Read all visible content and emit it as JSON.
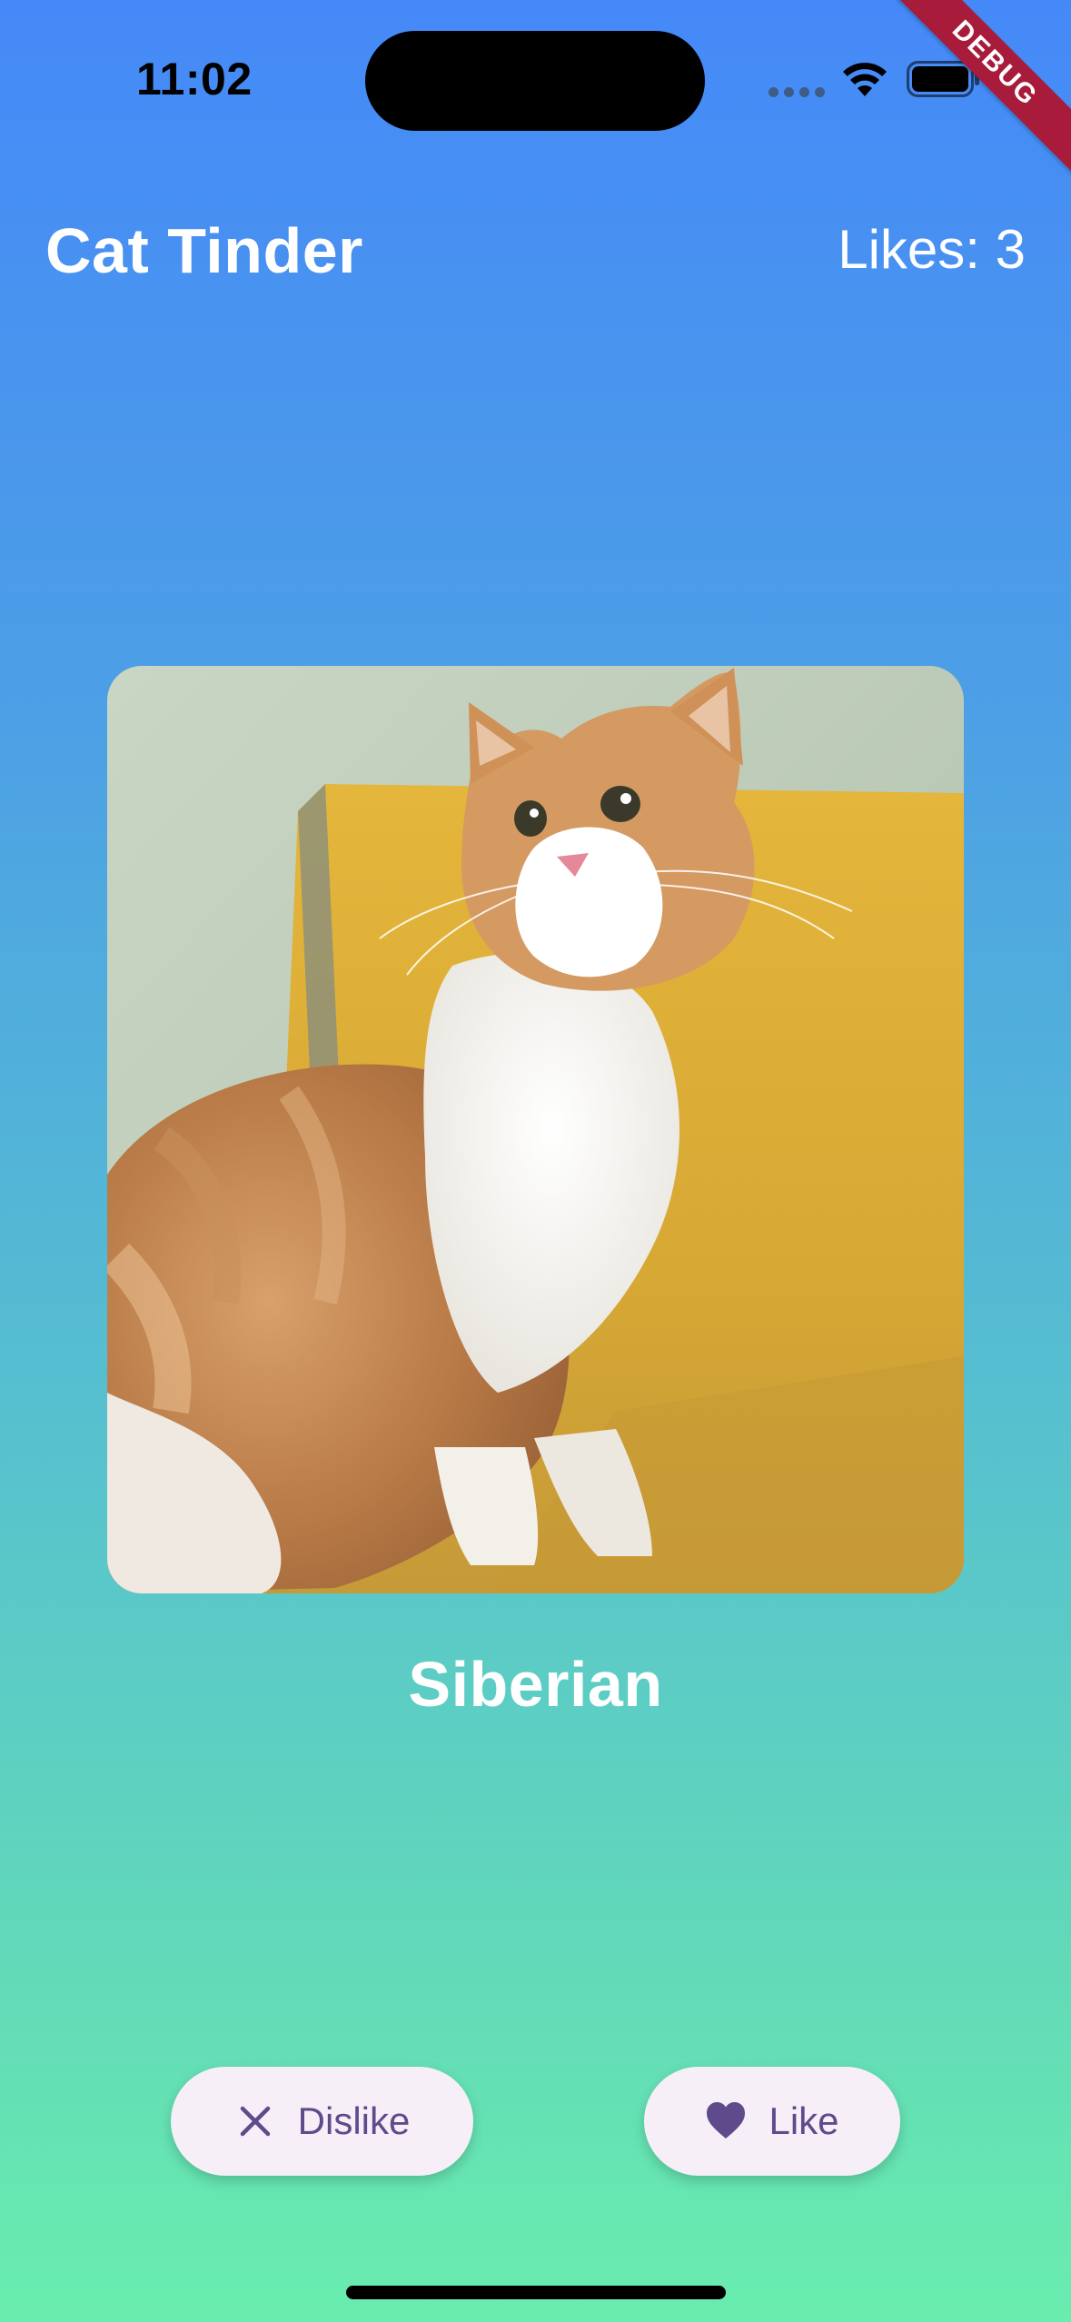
{
  "status_bar": {
    "time": "11:02",
    "wifi_icon": "wifi-icon",
    "battery_icon": "battery-icon"
  },
  "debug_banner": "DEBUG",
  "header": {
    "title": "Cat Tinder",
    "likes_label": "Likes: 3"
  },
  "card": {
    "image_semantic": "cat-photo",
    "breed": "Siberian"
  },
  "buttons": {
    "dislike_label": "Dislike",
    "dislike_icon": "close-icon",
    "like_label": "Like",
    "like_icon": "heart-icon"
  },
  "colors": {
    "accent": "#5f4b8b",
    "button_bg": "#f6eff8",
    "gradient_top": "#4589f8",
    "gradient_bottom": "#69edae"
  }
}
